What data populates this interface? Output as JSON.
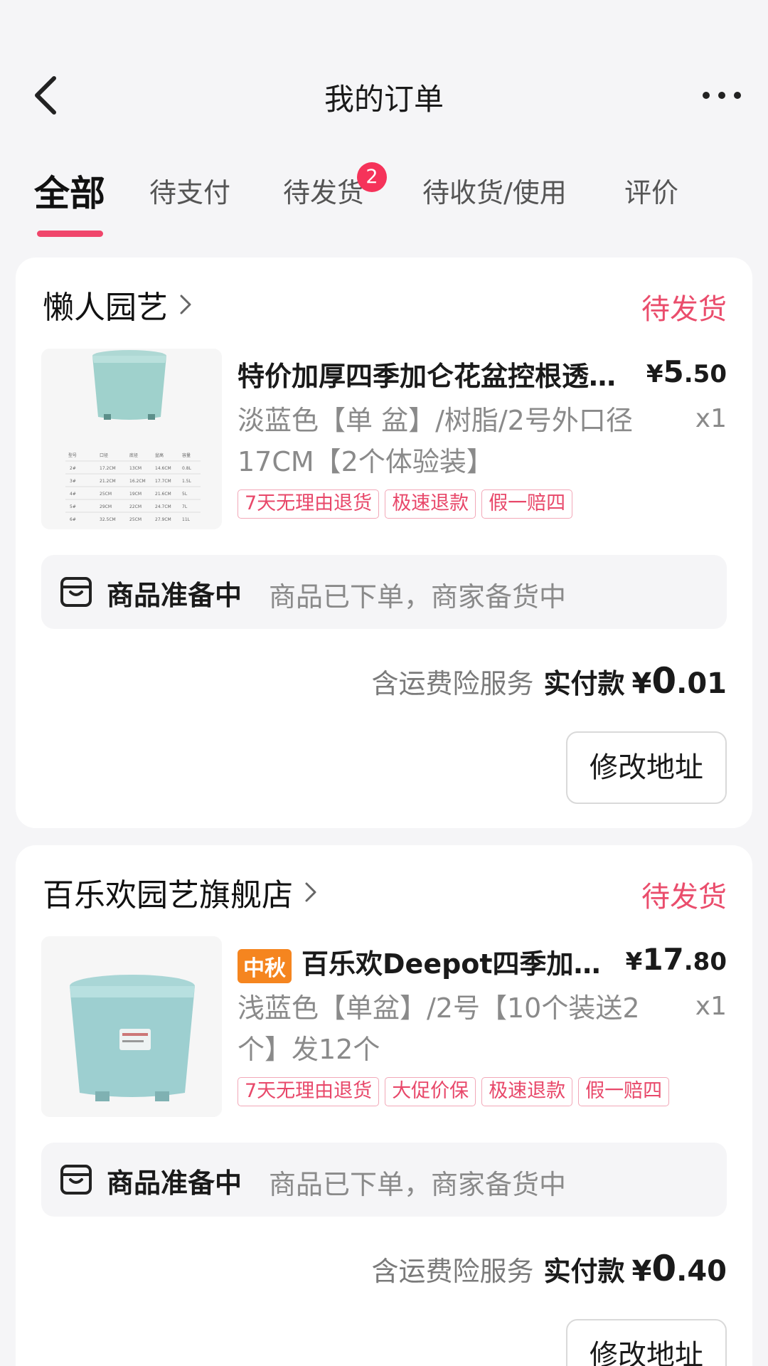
{
  "header": {
    "title": "我的订单",
    "back_icon": "chevron-left-icon",
    "more_icon": "more-dots-icon"
  },
  "tabs": [
    {
      "label": "全部",
      "active": true
    },
    {
      "label": "待支付"
    },
    {
      "label": "待发货",
      "badge": "2"
    },
    {
      "label": "待收货/使用"
    },
    {
      "label": "评价"
    }
  ],
  "colors": {
    "accent": "#f0466b",
    "status": "#ea4d6c",
    "promo": "#f5851f"
  },
  "orders": [
    {
      "shop": "懒人园艺",
      "status": "待发货",
      "product": {
        "title": "特价加厚四季加仑花盆控根透气塑料树脂花盆",
        "promo": "",
        "price_currency": "¥",
        "price_int": "5",
        "price_dec": ".50",
        "spec": "淡蓝色【单 盆】/树脂/2号外口径17CM【2个体验装】",
        "qty": "x1",
        "tags": [
          "7天无理由退货",
          "极速退款",
          "假一赔四"
        ],
        "size_table": {
          "headers": [
            "型号",
            "口径",
            "底径",
            "盆高",
            "容量"
          ],
          "rows": [
            [
              "2#",
              "17.2CM",
              "13CM",
              "14.6CM",
              "0.8L"
            ],
            [
              "3#",
              "21.2CM",
              "16.2CM",
              "17.7CM",
              "1.5L"
            ],
            [
              "4#",
              "25CM",
              "19CM",
              "21.6CM",
              "5L"
            ],
            [
              "5#",
              "29CM",
              "22CM",
              "24.7CM",
              "7L"
            ],
            [
              "6#",
              "32.5CM",
              "25CM",
              "27.9CM",
              "11L"
            ]
          ]
        }
      },
      "progress": {
        "title": "商品准备中",
        "detail": "商品已下单，商家备货中",
        "icon": "package-box-icon"
      },
      "payment": {
        "service": "含运费险服务",
        "label": "实付款",
        "currency": "¥",
        "amount_int": "0",
        "amount_dec": ".01"
      },
      "action": "修改地址"
    },
    {
      "shop": "百乐欢园艺旗舰店",
      "status": "待发货",
      "product": {
        "title": "百乐欢Deepot四季加仑盆塑料花盆",
        "promo": "中秋",
        "price_currency": "¥",
        "price_int": "17",
        "price_dec": ".80",
        "spec": "浅蓝色【单盆】/2号【10个装送2个】发12个",
        "qty": "x1",
        "tags": [
          "7天无理由退货",
          "大促价保",
          "极速退款",
          "假一赔四"
        ]
      },
      "progress": {
        "title": "商品准备中",
        "detail": "商品已下单，商家备货中",
        "icon": "package-box-icon"
      },
      "payment": {
        "service": "含运费险服务",
        "label": "实付款",
        "currency": "¥",
        "amount_int": "0",
        "amount_dec": ".40"
      },
      "action": "修改地址"
    }
  ]
}
